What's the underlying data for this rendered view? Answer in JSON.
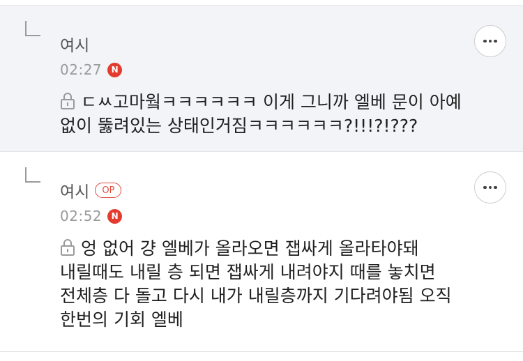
{
  "comments": [
    {
      "author": "여시",
      "is_op": false,
      "time": "02:27",
      "new_badge": "N",
      "text": "ㄷㅆ고마웤ㅋㅋㅋㅋㅋㅋ 이게 그니까 엘베 문이 아예\n없이 뚫려있는 상태인거짐ㅋㅋㅋㅋㅋㅋ?!!!?!???"
    },
    {
      "author": "여시",
      "is_op": true,
      "op_label": "OP",
      "time": "02:52",
      "new_badge": "N",
      "text": "엉 없어 걍 엘베가 올라오면 잽싸게 올라타야돼\n내릴때도 내릴 층 되면 잽싸게 내려야지 때를 놓치면\n전체층 다 돌고 다시 내가 내릴층까지 기다려야됨 오직\n한번의 기회 엘베"
    }
  ],
  "colors": {
    "highlight_bg": "#f3f4f8",
    "badge_red": "#e33b2e",
    "op_red": "#e24b3b"
  },
  "icons": [
    "reply-arrow-icon",
    "new-badge-icon",
    "lock-icon",
    "more-options-icon"
  ]
}
